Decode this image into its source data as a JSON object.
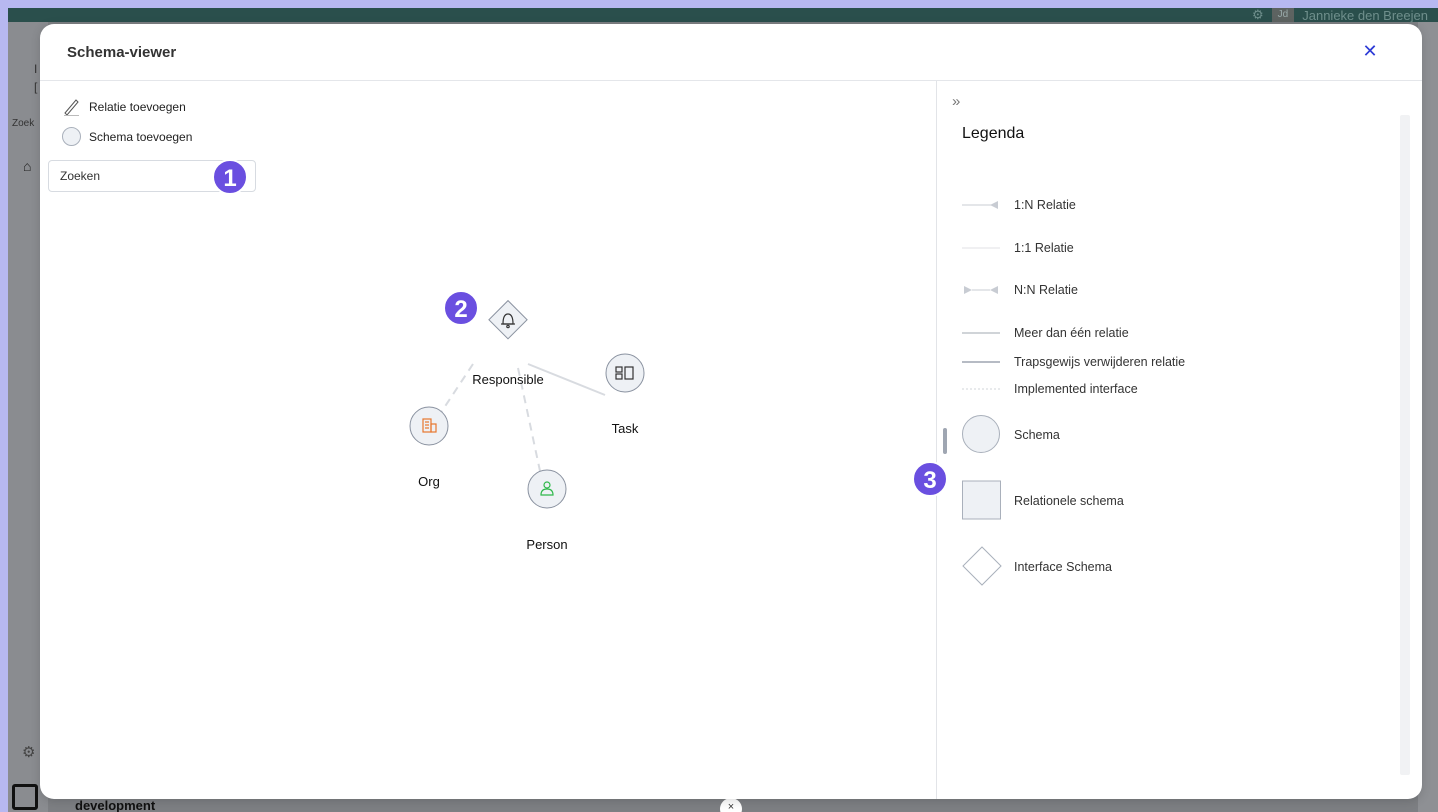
{
  "background": {
    "user_initials": "Jd",
    "user_name": "Jannieke den Breejen",
    "sidebar_search": "Zoek",
    "sidebar_line1": "I",
    "sidebar_line2": "[",
    "environment": "development",
    "close_glyph": "×"
  },
  "modal": {
    "title": "Schema-viewer",
    "close_glyph": "✕"
  },
  "toolbar": {
    "add_relation_label": "Relatie toevoegen",
    "add_schema_label": "Schema toevoegen",
    "search_placeholder": "Zoeken"
  },
  "graph": {
    "nodes": [
      {
        "id": "responsible",
        "label": "Responsible",
        "shape": "diamond",
        "icon": "bell-icon"
      },
      {
        "id": "task",
        "label": "Task",
        "shape": "circle",
        "icon": "board-icon"
      },
      {
        "id": "org",
        "label": "Org",
        "shape": "circle",
        "icon": "building-icon",
        "icon_color": "#e8772e"
      },
      {
        "id": "person",
        "label": "Person",
        "shape": "circle",
        "icon": "person-icon",
        "icon_color": "#2fb84a"
      }
    ],
    "edges": [
      {
        "from": "responsible",
        "to": "task",
        "style": "solid"
      },
      {
        "from": "responsible",
        "to": "org",
        "style": "dashed"
      },
      {
        "from": "responsible",
        "to": "person",
        "style": "dashed"
      }
    ]
  },
  "badges": [
    "1",
    "2",
    "3"
  ],
  "legend": {
    "collapse_glyph": "»",
    "title": "Legenda",
    "items": [
      {
        "label": "1:N Relatie",
        "symbol": "line-arrow"
      },
      {
        "label": "1:1 Relatie",
        "symbol": "line-thin"
      },
      {
        "label": "N:N Relatie",
        "symbol": "double-arrow"
      },
      {
        "label": "Meer dan één relatie",
        "symbol": "line-solid"
      },
      {
        "label": "Trapsgewijs verwijderen relatie",
        "symbol": "line-dark"
      },
      {
        "label": "Implemented interface",
        "symbol": "line-dotted"
      },
      {
        "label": "Schema",
        "symbol": "circle"
      },
      {
        "label": "Relationele schema",
        "symbol": "square"
      },
      {
        "label": "Interface Schema",
        "symbol": "diamond"
      }
    ]
  },
  "colors": {
    "accent": "#2d3bd6",
    "badge": "#6a4fe0",
    "node_fill": "#eef1f5",
    "node_stroke": "#8a92a0"
  }
}
